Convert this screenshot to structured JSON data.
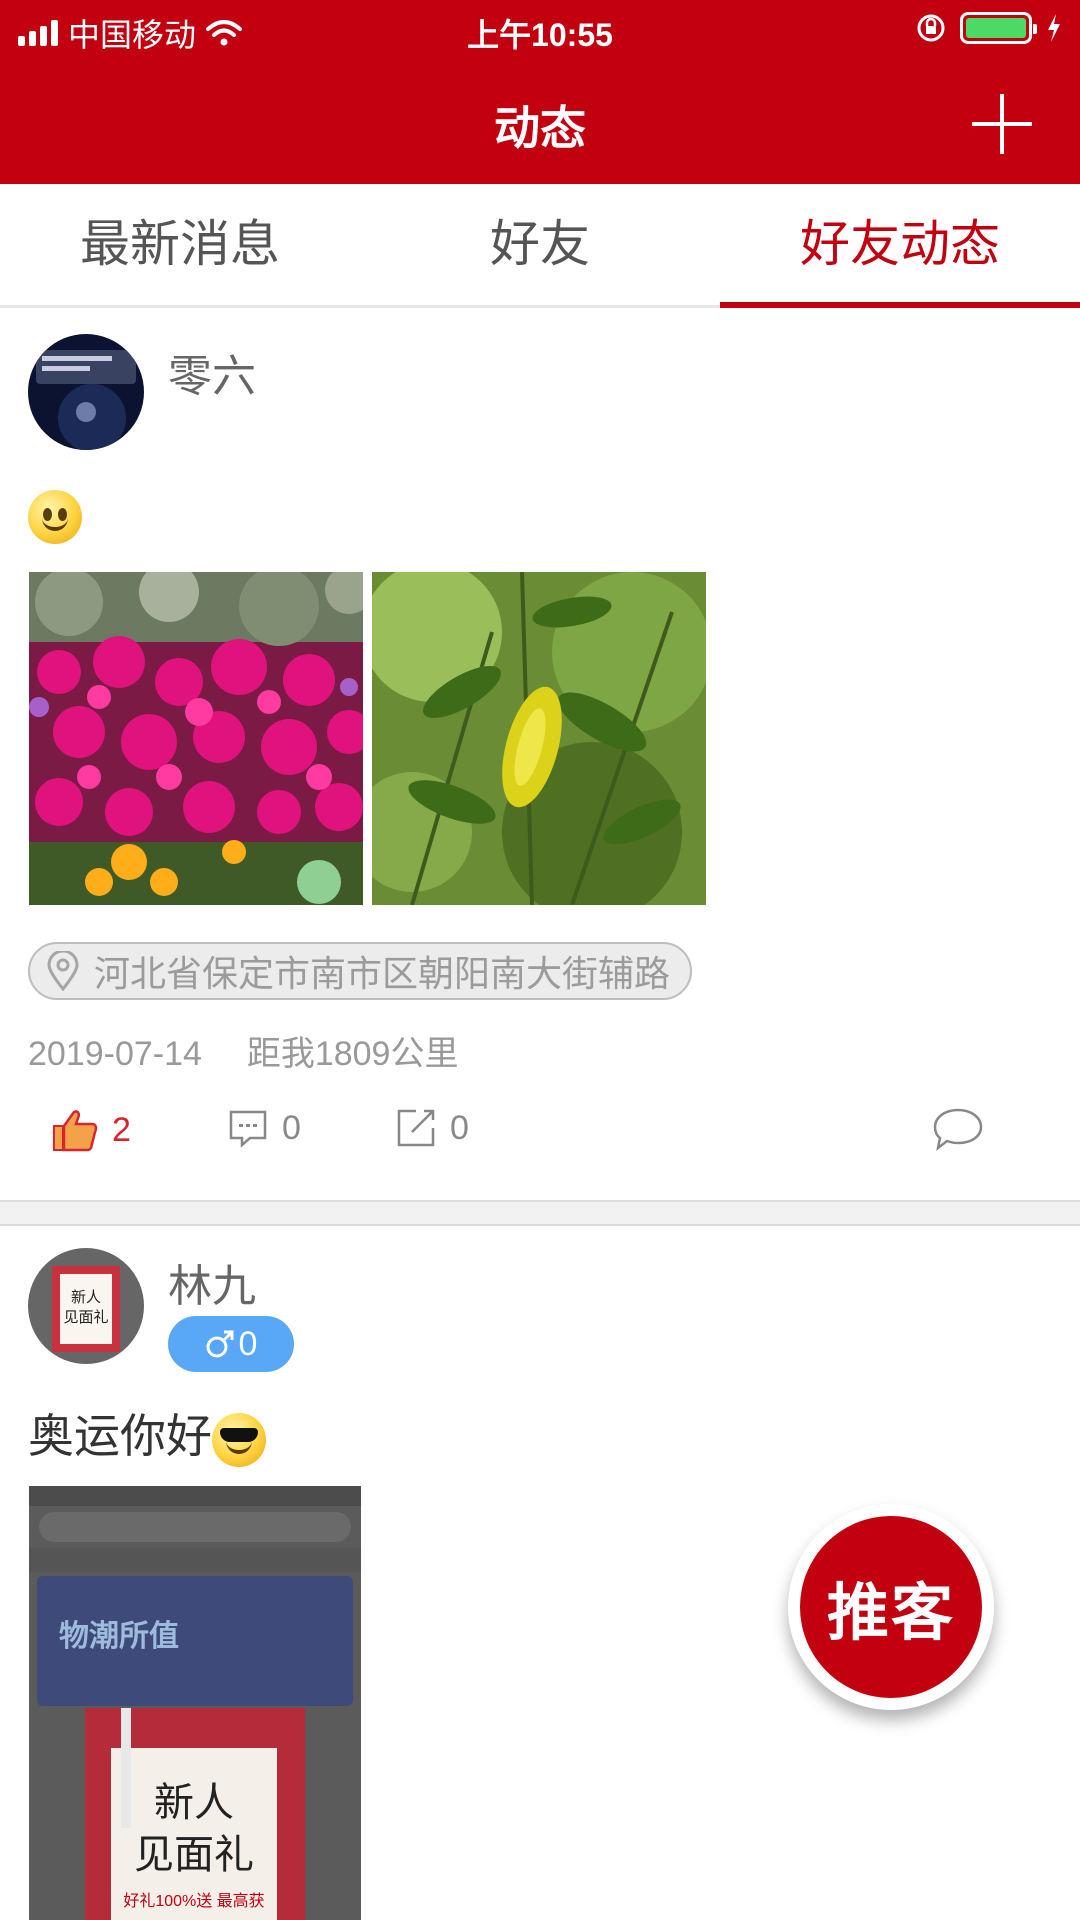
{
  "status_bar": {
    "carrier": "中国移动",
    "time": "上午10:55",
    "battery_color": "#4cd964"
  },
  "nav": {
    "title": "动态",
    "add_icon": "plus-icon"
  },
  "tabs": [
    {
      "label": "最新消息",
      "active": false
    },
    {
      "label": "好友",
      "active": false
    },
    {
      "label": "好友动态",
      "active": true
    }
  ],
  "posts": [
    {
      "username": "零六",
      "content": "",
      "content_emoji": "smile-emoji",
      "location": "河北省保定市南市区朝阳南大街辅路",
      "date": "2019-07-14",
      "distance": "距我1809公里",
      "likes": "2",
      "comments": "0",
      "shares": "0"
    },
    {
      "username": "林九",
      "gender_count": "0",
      "content": "奥运你好",
      "content_emoji": "sunglasses-emoji",
      "avatar_text_line1": "新人",
      "avatar_text_line2": "见面礼",
      "image_text_line1": "新人",
      "image_text_line2": "见面礼",
      "image_text_line3": "好礼100%送 最高获",
      "image_banner": "物潮所值"
    }
  ],
  "fab": {
    "label": "推客"
  },
  "colors": {
    "primary": "#c2000f",
    "gender_badge": "#58a8f7"
  }
}
